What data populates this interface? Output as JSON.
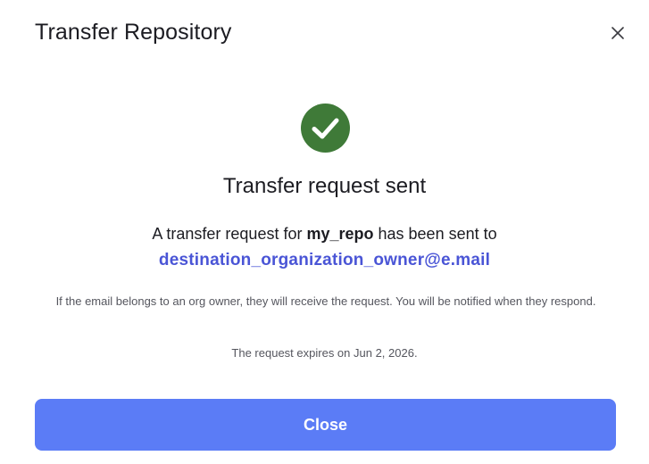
{
  "dialog": {
    "title": "Transfer Repository",
    "close_icon": "close-icon"
  },
  "status": {
    "icon": "check-circle-icon",
    "icon_color": "#3f7a38",
    "heading": "Transfer request sent"
  },
  "message": {
    "prefix": "A transfer request for ",
    "repo_name": "my_repo",
    "suffix": " has been sent to",
    "recipient_email": "destination_organization_owner@e.mail",
    "email_color": "#4a55d6"
  },
  "info": {
    "note": "If the email belongs to an org owner, they will receive the request. You will be notified when they respond.",
    "expiry": "The request expires on Jun 2, 2026."
  },
  "actions": {
    "close_label": "Close",
    "button_color": "#5b7cf6"
  }
}
